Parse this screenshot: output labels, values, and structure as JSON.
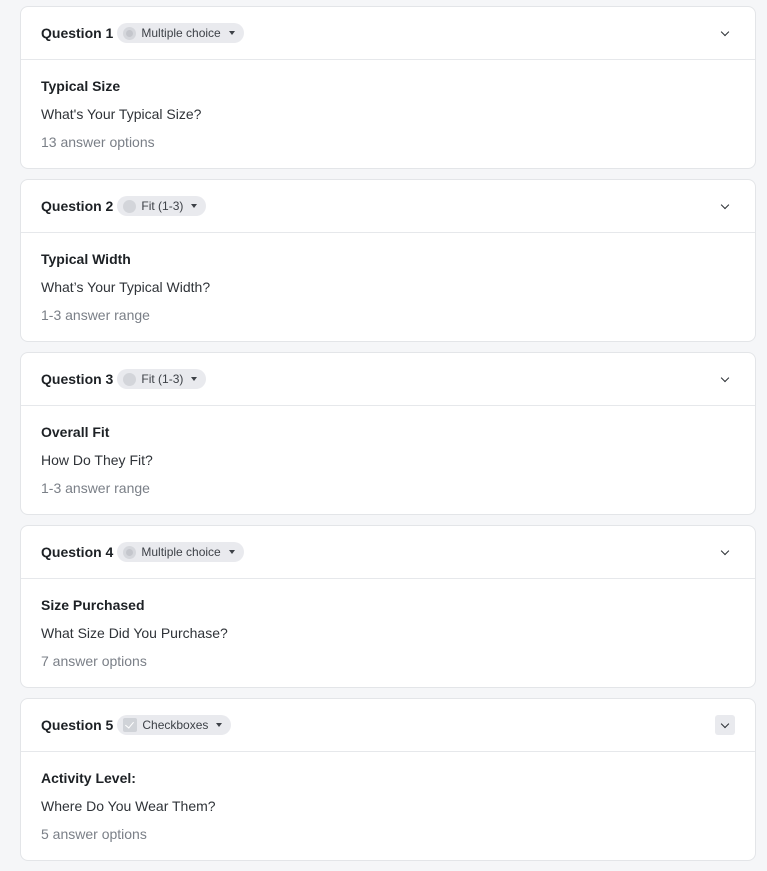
{
  "questions": [
    {
      "number_label": "Question 1",
      "type_label": "Multiple choice",
      "type_icon": "radio-icon",
      "title": "Typical Size",
      "text": "What's Your Typical Size?",
      "meta": "13 answer options"
    },
    {
      "number_label": "Question 2",
      "type_label": "Fit (1-3)",
      "type_icon": "fit-icon",
      "title": "Typical Width",
      "text": "What’s Your Typical Width?",
      "meta": "1-3 answer range"
    },
    {
      "number_label": "Question 3",
      "type_label": "Fit (1-3)",
      "type_icon": "fit-icon",
      "title": "Overall Fit",
      "text": "How Do They Fit?",
      "meta": "1-3 answer range"
    },
    {
      "number_label": "Question 4",
      "type_label": "Multiple choice",
      "type_icon": "radio-icon",
      "title": "Size Purchased",
      "text": "What Size Did You Purchase?",
      "meta": "7 answer options"
    },
    {
      "number_label": "Question 5",
      "type_label": "Checkboxes",
      "type_icon": "checkbox-icon",
      "title": "Activity Level:",
      "text": "Where Do You Wear Them?",
      "meta": "5 answer options"
    }
  ]
}
